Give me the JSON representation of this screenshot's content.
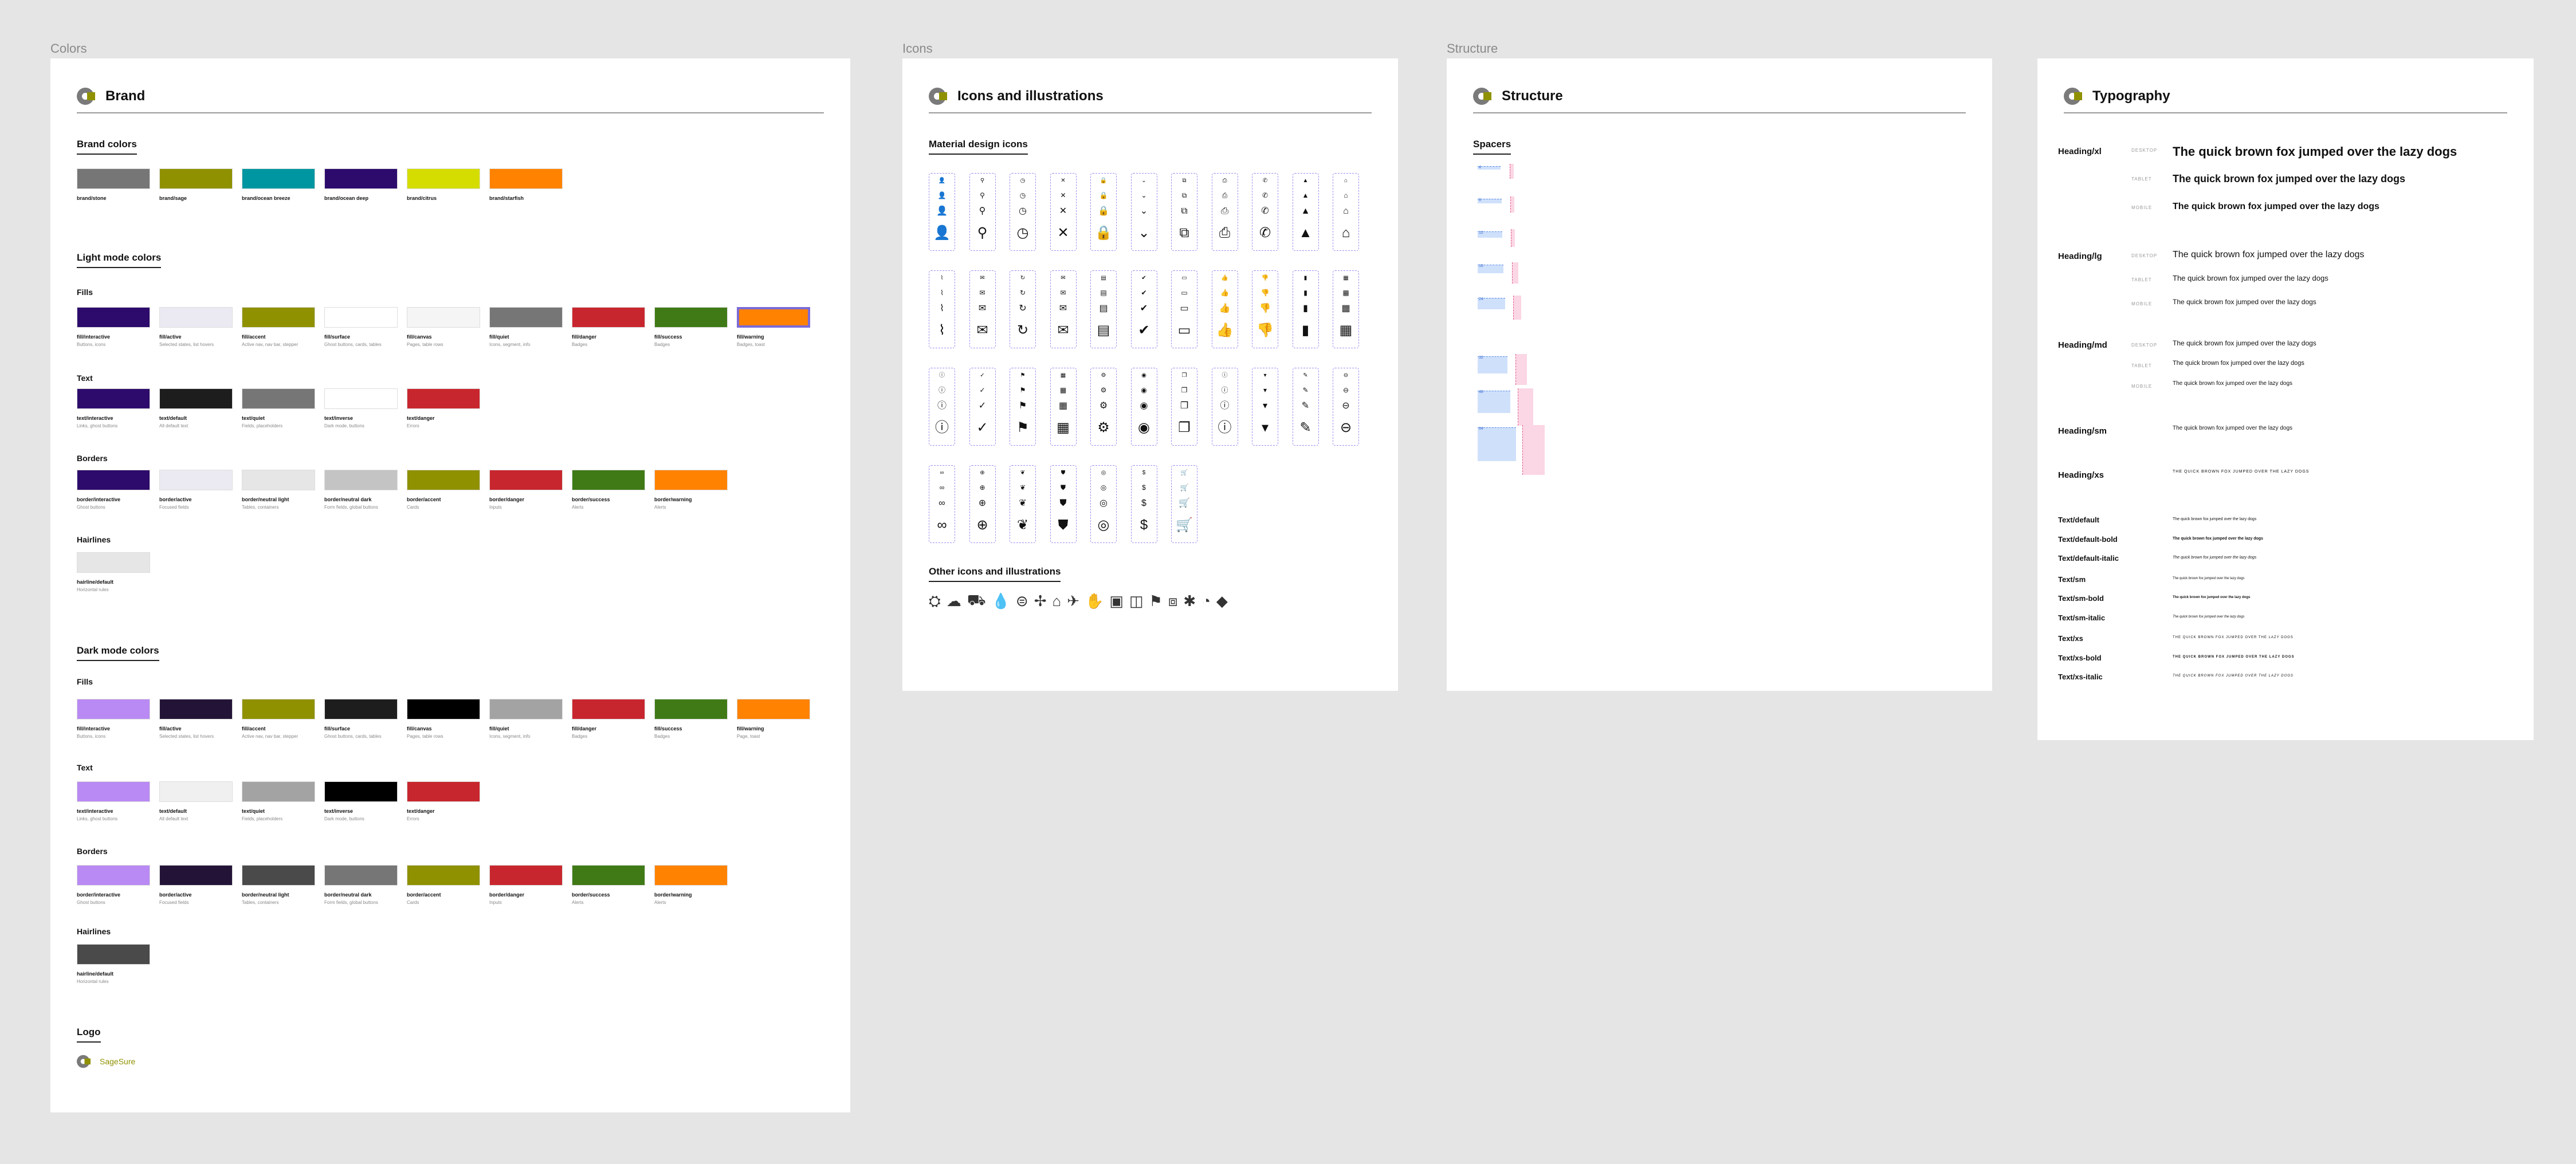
{
  "frames": {
    "colors": "Colors",
    "icons": "Icons",
    "structure": "Structure"
  },
  "brand": {
    "title": "Brand",
    "brand_colors": "Brand colors",
    "swatches": [
      {
        "name": "brand/stone",
        "color": "#767676"
      },
      {
        "name": "brand/sage",
        "color": "#8f9100"
      },
      {
        "name": "brand/ocean breeze",
        "color": "#0096a1"
      },
      {
        "name": "brand/ocean deep",
        "color": "#2d0b6c"
      },
      {
        "name": "brand/citrus",
        "color": "#d4dc00"
      },
      {
        "name": "brand/starfish",
        "color": "#ff8200"
      }
    ],
    "light_mode": {
      "title": "Light mode colors",
      "fills_label": "Fills",
      "fills": [
        {
          "name": "fill/interactive",
          "desc": "Buttons, icons",
          "color": "#2d0b6c"
        },
        {
          "name": "fill/active",
          "desc": "Selected states, list hovers",
          "color": "#ebeaf2"
        },
        {
          "name": "fill/accent",
          "desc": "Active nav, nav bar, stepper",
          "color": "#8f9100"
        },
        {
          "name": "fill/surface",
          "desc": "Ghost buttons, cards, tables",
          "color": "#ffffff"
        },
        {
          "name": "fill/canvas",
          "desc": "Pages, table rows",
          "color": "#f5f5f5"
        },
        {
          "name": "fill/quiet",
          "desc": "Icons, segment, info",
          "color": "#767676"
        },
        {
          "name": "fill/danger",
          "desc": "Badges",
          "color": "#c8262e"
        },
        {
          "name": "fill/success",
          "desc": "Badges",
          "color": "#3f7a17"
        },
        {
          "name": "fill/warning",
          "desc": "Badges, toast",
          "color": "#ff8200"
        }
      ],
      "text_label": "Text",
      "text": [
        {
          "name": "text/interactive",
          "desc": "Links, ghost buttons",
          "color": "#2d0b6c"
        },
        {
          "name": "text/default",
          "desc": "All default text",
          "color": "#1d1d1d"
        },
        {
          "name": "text/quiet",
          "desc": "Fields, placeholders",
          "color": "#767676"
        },
        {
          "name": "text/inverse",
          "desc": "Dark mode, buttons",
          "color": "#ffffff"
        },
        {
          "name": "text/danger",
          "desc": "Errors",
          "color": "#c8262e"
        }
      ],
      "borders_label": "Borders",
      "borders": [
        {
          "name": "border/interactive",
          "desc": "Ghost buttons",
          "color": "#2d0b6c"
        },
        {
          "name": "border/active",
          "desc": "Focused fields",
          "color": "#ebeaf2"
        },
        {
          "name": "border/neutral light",
          "desc": "Tables, containers",
          "color": "#e6e6e6"
        },
        {
          "name": "border/neutral dark",
          "desc": "Form fields, global buttons",
          "color": "#c4c4c4"
        },
        {
          "name": "border/accent",
          "desc": "Cards",
          "color": "#8f9100"
        },
        {
          "name": "border/danger",
          "desc": "Inputs",
          "color": "#c8262e"
        },
        {
          "name": "border/success",
          "desc": "Alerts",
          "color": "#3f7a17"
        },
        {
          "name": "border/warning",
          "desc": "Alerts",
          "color": "#ff8200"
        }
      ],
      "hairlines_label": "Hairlines",
      "hairlines": [
        {
          "name": "hairline/default",
          "desc": "Horizontal rules",
          "color": "#e6e6e6"
        }
      ]
    },
    "dark_mode": {
      "title": "Dark mode colors",
      "fills_label": "Fills",
      "fills": [
        {
          "name": "fill/interactive",
          "desc": "Buttons, icons",
          "color": "#b98af3"
        },
        {
          "name": "fill/active",
          "desc": "Selected states, list hovers",
          "color": "#231437"
        },
        {
          "name": "fill/accent",
          "desc": "Active nav, nav bar, stepper",
          "color": "#8f9100"
        },
        {
          "name": "fill/surface",
          "desc": "Ghost buttons, cards, tables",
          "color": "#1d1d1d"
        },
        {
          "name": "fill/canvas",
          "desc": "Pages, table rows",
          "color": "#000000"
        },
        {
          "name": "fill/quiet",
          "desc": "Icons, segment, info",
          "color": "#a3a3a3"
        },
        {
          "name": "fill/danger",
          "desc": "Badges",
          "color": "#c8262e"
        },
        {
          "name": "fill/success",
          "desc": "Badges",
          "color": "#3f7a17"
        },
        {
          "name": "fill/warning",
          "desc": "Page, toast",
          "color": "#ff8200"
        }
      ],
      "text_label": "Text",
      "text": [
        {
          "name": "text/interactive",
          "desc": "Links, ghost buttons",
          "color": "#b98af3"
        },
        {
          "name": "text/default",
          "desc": "All default text",
          "color": "#f0f0f0"
        },
        {
          "name": "text/quiet",
          "desc": "Fields, placeholders",
          "color": "#a3a3a3"
        },
        {
          "name": "text/inverse",
          "desc": "Dark mode, buttons",
          "color": "#000000"
        },
        {
          "name": "text/danger",
          "desc": "Errors",
          "color": "#c8262e"
        }
      ],
      "borders_label": "Borders",
      "borders": [
        {
          "name": "border/interactive",
          "desc": "Ghost buttons",
          "color": "#b98af3"
        },
        {
          "name": "border/active",
          "desc": "Focused fields",
          "color": "#231437"
        },
        {
          "name": "border/neutral light",
          "desc": "Tables, containers",
          "color": "#4a4a4a"
        },
        {
          "name": "border/neutral dark",
          "desc": "Form fields, global buttons",
          "color": "#767676"
        },
        {
          "name": "border/accent",
          "desc": "Cards",
          "color": "#8f9100"
        },
        {
          "name": "border/danger",
          "desc": "Inputs",
          "color": "#c8262e"
        },
        {
          "name": "border/success",
          "desc": "Alerts",
          "color": "#3f7a17"
        },
        {
          "name": "border/warning",
          "desc": "Alerts",
          "color": "#ff8200"
        }
      ],
      "hairlines_label": "Hairlines",
      "hairlines": [
        {
          "name": "hairline/default",
          "desc": "Horizontal rules",
          "color": "#4a4a4a"
        }
      ]
    },
    "logo_label": "Logo",
    "logo_text": "SageSure"
  },
  "icons": {
    "title": "Icons and illustrations",
    "material_label": "Material design icons",
    "material": [
      "person-icon",
      "search-icon",
      "clock-icon",
      "close-icon",
      "lock-icon",
      "chevron-down-icon",
      "open-in-new-icon",
      "print-icon",
      "phone-icon",
      "warning-icon",
      "home-icon",
      "attachment-icon",
      "chat-icon",
      "refresh-icon",
      "mail-icon",
      "document-icon",
      "check-circle-icon",
      "payment-icon",
      "thumb-up-icon",
      "thumb-down-icon",
      "file-icon",
      "news-icon",
      "info-icon",
      "check-icon",
      "flag-icon",
      "calendar-icon",
      "settings-icon",
      "eye-icon",
      "copy-icon",
      "alert-icon",
      "arrow-drop-down-icon",
      "edit-icon",
      "remove-circle-icon",
      "link-icon",
      "add-circle-icon",
      "leaf-icon",
      "shield-icon",
      "badge-icon",
      "dollar-icon",
      "cart-icon"
    ],
    "glyphs": {
      "person-icon": "👤",
      "search-icon": "⚲",
      "clock-icon": "◷",
      "close-icon": "✕",
      "lock-icon": "🔒",
      "chevron-down-icon": "⌄",
      "open-in-new-icon": "⧉",
      "print-icon": "⎙",
      "phone-icon": "✆",
      "warning-icon": "▲",
      "home-icon": "⌂",
      "attachment-icon": "⌇",
      "chat-icon": "✉",
      "refresh-icon": "↻",
      "mail-icon": "✉",
      "document-icon": "▤",
      "check-circle-icon": "✔",
      "payment-icon": "▭",
      "thumb-up-icon": "👍",
      "thumb-down-icon": "👎",
      "file-icon": "▮",
      "news-icon": "▦",
      "info-icon": "ⓘ",
      "check-icon": "✓",
      "flag-icon": "⚑",
      "calendar-icon": "▦",
      "settings-icon": "⚙",
      "eye-icon": "◉",
      "copy-icon": "❐",
      "alert-icon": "ⓘ",
      "arrow-drop-down-icon": "▾",
      "edit-icon": "✎",
      "remove-circle-icon": "⊖",
      "link-icon": "∞",
      "add-circle-icon": "⊕",
      "leaf-icon": "❦",
      "shield-icon": "⛊",
      "badge-icon": "◎",
      "dollar-icon": "$",
      "cart-icon": "🛒"
    },
    "other_label": "Other icons and illustrations",
    "other": [
      "⛭",
      "☁",
      "⛟",
      "💧",
      "⊜",
      "✢",
      "⌂",
      "✈",
      "✋",
      "▣",
      "◫",
      "⚑",
      "⧈",
      "✱",
      "◔",
      "◆"
    ]
  },
  "structure": {
    "title": "Structure",
    "spacers_label": "Spacers",
    "spacers": [
      {
        "label": "4"
      },
      {
        "label": "8"
      },
      {
        "label": "12"
      },
      {
        "label": "16"
      },
      {
        "label": "24"
      },
      {
        "label": "32"
      },
      {
        "label": "48"
      },
      {
        "label": "64"
      }
    ]
  },
  "typography": {
    "title": "Typography",
    "sample": "The quick brown fox jumped over the lazy dogs",
    "sizes": [
      "DESKTOP",
      "TABLET",
      "MOBILE"
    ],
    "headings": [
      {
        "name": "Heading/xl",
        "sizes": [
          22,
          18,
          16
        ],
        "weight": "bold"
      },
      {
        "name": "Heading/lg",
        "sizes": [
          16,
          13,
          12
        ],
        "weight": "normal"
      },
      {
        "name": "Heading/md",
        "sizes": [
          12,
          11,
          10
        ],
        "weight": "normal"
      },
      {
        "name": "Heading/sm",
        "sizes": [
          10
        ],
        "weight": "normal"
      },
      {
        "name": "Heading/xs",
        "sizes": [
          7
        ],
        "weight": "caps"
      }
    ],
    "text_styles": [
      {
        "name": "Text/default",
        "weight": "normal",
        "size": 7
      },
      {
        "name": "Text/default-bold",
        "weight": "bold",
        "size": 7
      },
      {
        "name": "Text/default-italic",
        "weight": "italic",
        "size": 7
      },
      {
        "name": "Text/sm",
        "weight": "normal",
        "size": 6
      },
      {
        "name": "Text/sm-bold",
        "weight": "bold",
        "size": 6
      },
      {
        "name": "Text/sm-italic",
        "weight": "italic",
        "size": 6
      },
      {
        "name": "Text/xs",
        "weight": "caps",
        "size": 6
      },
      {
        "name": "Text/xs-bold",
        "weight": "capsbold",
        "size": 6
      },
      {
        "name": "Text/xs-italic",
        "weight": "capsitalic",
        "size": 6
      }
    ]
  }
}
